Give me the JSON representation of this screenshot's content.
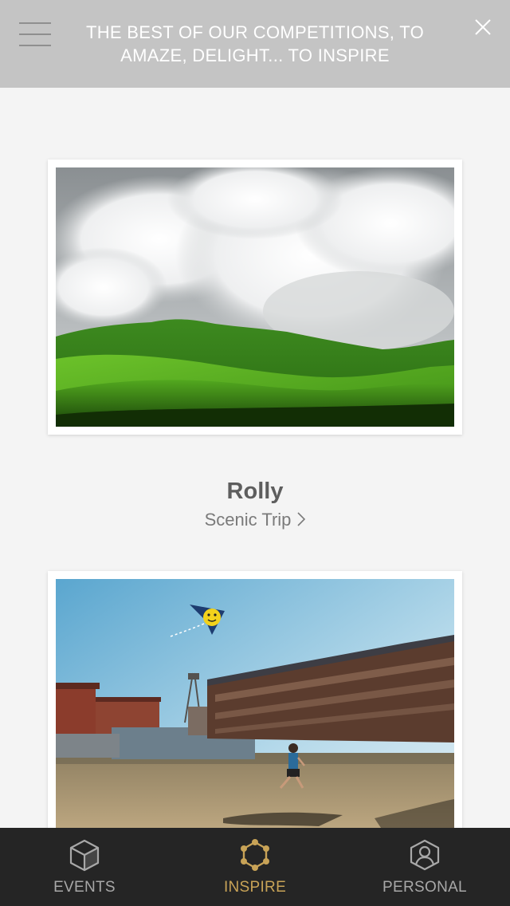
{
  "header": {
    "title": "THE BEST OF OUR COMPETITIONS, TO AMAZE, DELIGHT... TO INSPIRE",
    "menu_icon": "hamburger-menu-icon",
    "close_icon": "close-x-icon"
  },
  "feed": {
    "items": [
      {
        "author": "Rolly",
        "category": "Scenic Trip",
        "photo": "green rolling hills under large white clouds"
      },
      {
        "photo": "child flying a smiley-face kite in front of apartment buildings"
      }
    ]
  },
  "tabbar": {
    "tabs": [
      {
        "label": "EVENTS",
        "icon": "cube-icon",
        "active": false
      },
      {
        "label": "INSPIRE",
        "icon": "hexagon-network-icon",
        "active": true
      },
      {
        "label": "PERSONAL",
        "icon": "person-hexagon-icon",
        "active": false
      }
    ]
  },
  "colors": {
    "header_bg": "#c4c4c4",
    "background": "#f4f4f4",
    "tabbar_bg": "#252525",
    "active_tab": "#c8a357",
    "inactive_tab": "#a8a8a8"
  }
}
